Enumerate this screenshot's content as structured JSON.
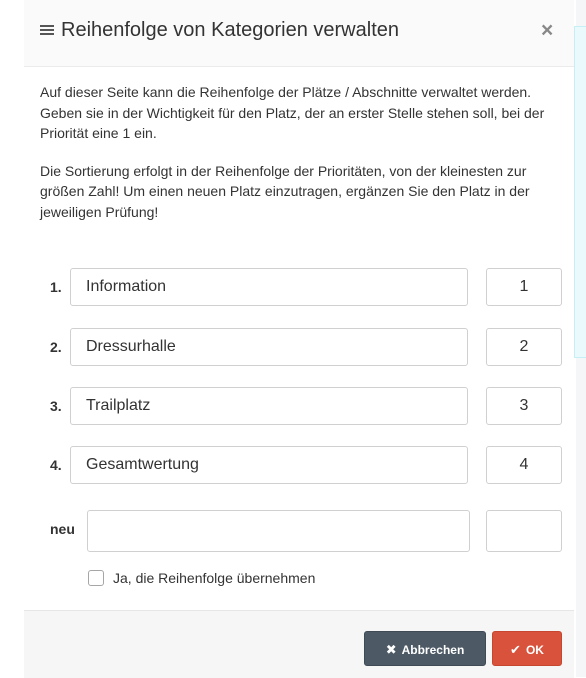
{
  "dialog": {
    "title": "Reihenfolge von Kategorien verwalten",
    "title_icon": "list-icon",
    "close_label": "×",
    "paragraph1": "Auf dieser Seite kann die Reihenfolge der Plätze / Abschnitte verwaltet werden. Geben sie in der Wichtigkeit für den Platz, der an erster Stelle stehen soll, bei der Priorität eine 1 ein.",
    "paragraph2": "Die Sortierung erfolgt in der Reihenfolge der Prioritäten, von der kleinesten zur größen Zahl! Um einen neuen Platz einzutragen, ergänzen Sie den Platz in der jeweiligen Prüfung!"
  },
  "rows": [
    {
      "label": "1.",
      "name": "Information",
      "priority": "1"
    },
    {
      "label": "2.",
      "name": "Dressurhalle",
      "priority": "2"
    },
    {
      "label": "3.",
      "name": "Trailplatz",
      "priority": "3"
    },
    {
      "label": "4.",
      "name": "Gesamtwertung",
      "priority": "4"
    }
  ],
  "new_row": {
    "label": "neu",
    "name": "",
    "priority": ""
  },
  "checkbox": {
    "label": "Ja, die Reihenfolge übernehmen",
    "checked": false
  },
  "footer": {
    "cancel_label": "Abbrechen",
    "cancel_icon": "close-icon",
    "ok_label": "OK",
    "ok_icon": "check-icon"
  },
  "colors": {
    "cancel_bg": "#4d5a66",
    "ok_bg": "#d9523b"
  }
}
